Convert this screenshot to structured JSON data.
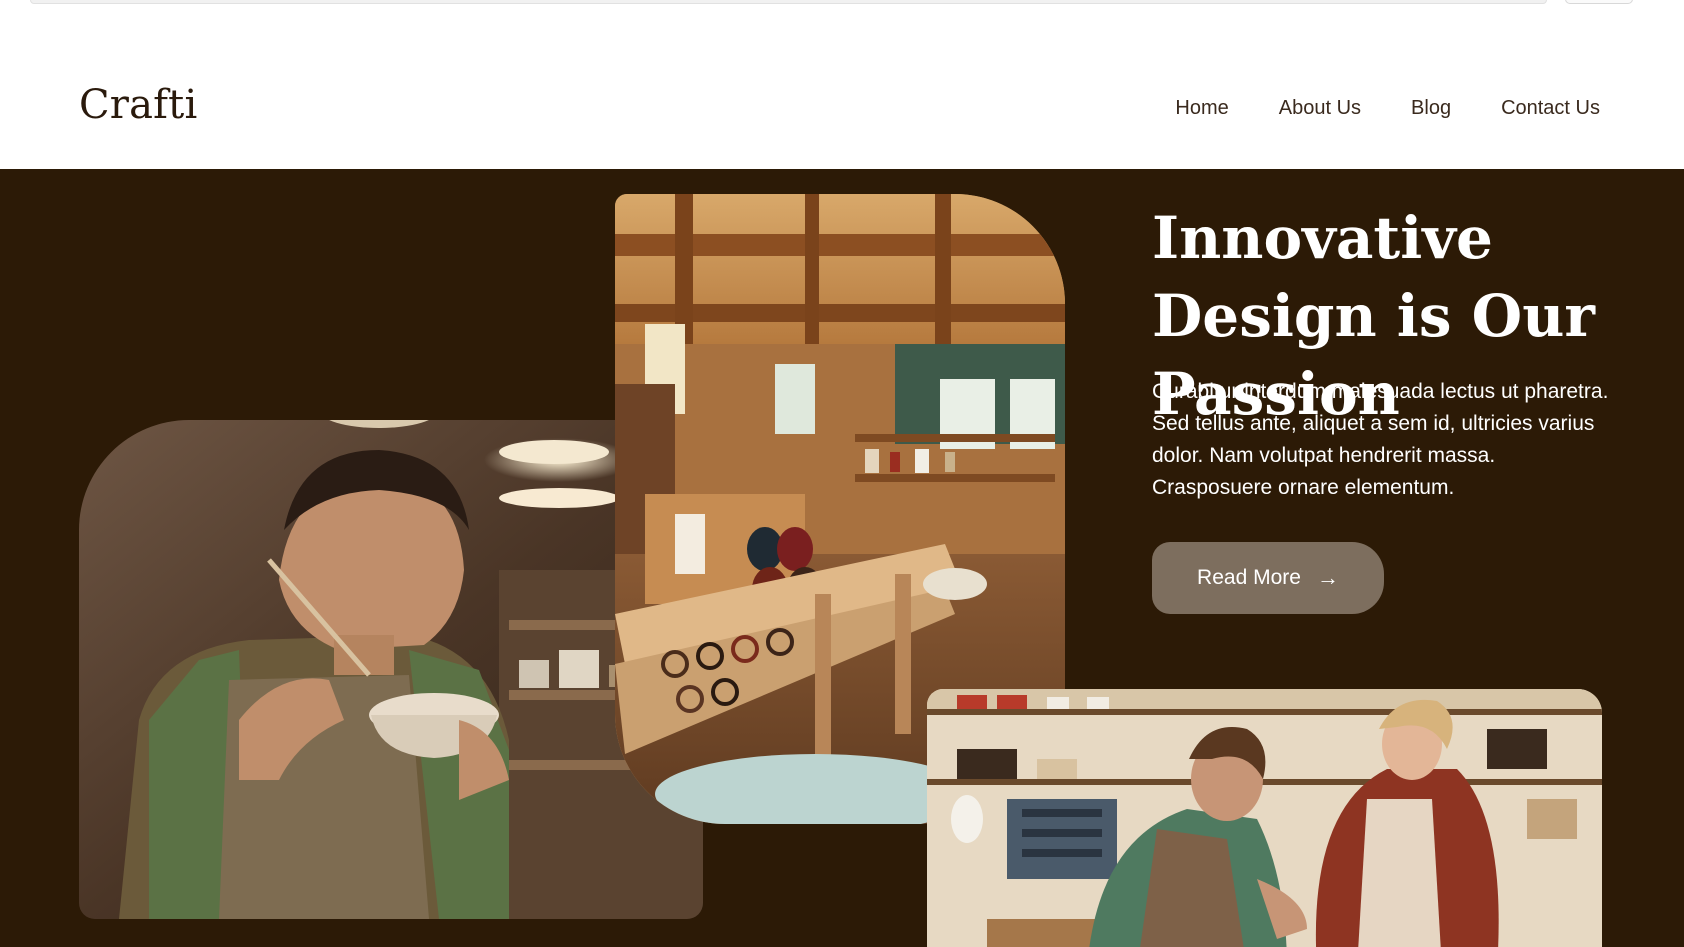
{
  "brand": {
    "logo": "Crafti"
  },
  "nav": {
    "items": [
      {
        "label": "Home"
      },
      {
        "label": "About Us"
      },
      {
        "label": "Blog"
      },
      {
        "label": "Contact Us"
      }
    ]
  },
  "hero": {
    "headline": "Innovative Design is Our Passion",
    "body": "Curabitur interdum malesuada lectus ut pharetra. Sed tellus ante, aliquet a sem id, ultricies varius dolor. Nam volutpat hendrerit massa. Crasposuere ornare elementum.",
    "button_label": "Read More",
    "button_icon": "arrow-right-icon",
    "colors": {
      "background": "#2c1a06",
      "button": "#7d6e5e",
      "text": "#ffffff"
    }
  }
}
